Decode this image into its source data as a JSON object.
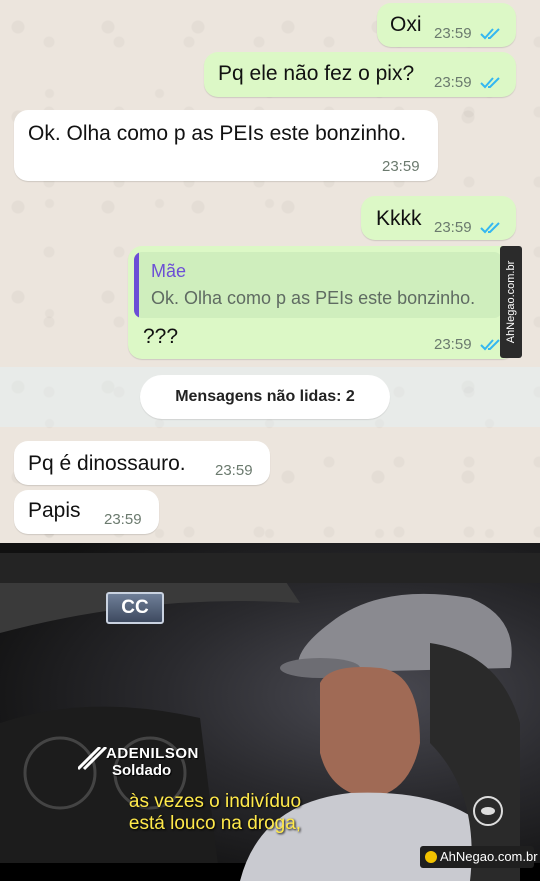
{
  "messages": [
    {
      "id": "m1",
      "direction": "out",
      "text": "Oxi",
      "time": "23:59"
    },
    {
      "id": "m2",
      "direction": "out",
      "text": "Pq ele não fez o pix?",
      "time": "23:59"
    },
    {
      "id": "m3",
      "direction": "in",
      "text": "Ok. Olha como p as PEIs este bonzinho.",
      "time": "23:59"
    },
    {
      "id": "m4",
      "direction": "out",
      "text": "Kkkk",
      "time": "23:59"
    },
    {
      "id": "m5",
      "direction": "out",
      "text": "???",
      "time": "23:59",
      "quote": {
        "author": "Mãe",
        "text": "Ok. Olha como p as PEIs este bonzinho."
      }
    },
    {
      "id": "m6",
      "direction": "in",
      "text": "Pq é dinossauro.",
      "time": "23:59"
    },
    {
      "id": "m7",
      "direction": "in",
      "text": "Papis",
      "time": "23:59"
    }
  ],
  "unread_divider": "Mensagens não lidas: 2",
  "watermark": "AhNegao.com.br",
  "colors": {
    "outgoing_bubble": "#dcf8c6",
    "incoming_bubble": "#ffffff",
    "read_ticks": "#34b7f1",
    "quote_accent": "#6c4fd6",
    "subtitle_yellow": "#ffe94a"
  },
  "photo": {
    "description_icon": "cc-icon",
    "cc_label": "CC",
    "name_tag": {
      "name": "ADENILSON",
      "role": "Soldado"
    },
    "subtitle_lines": [
      "às vezes o indivíduo",
      "está louco na droga,"
    ]
  }
}
